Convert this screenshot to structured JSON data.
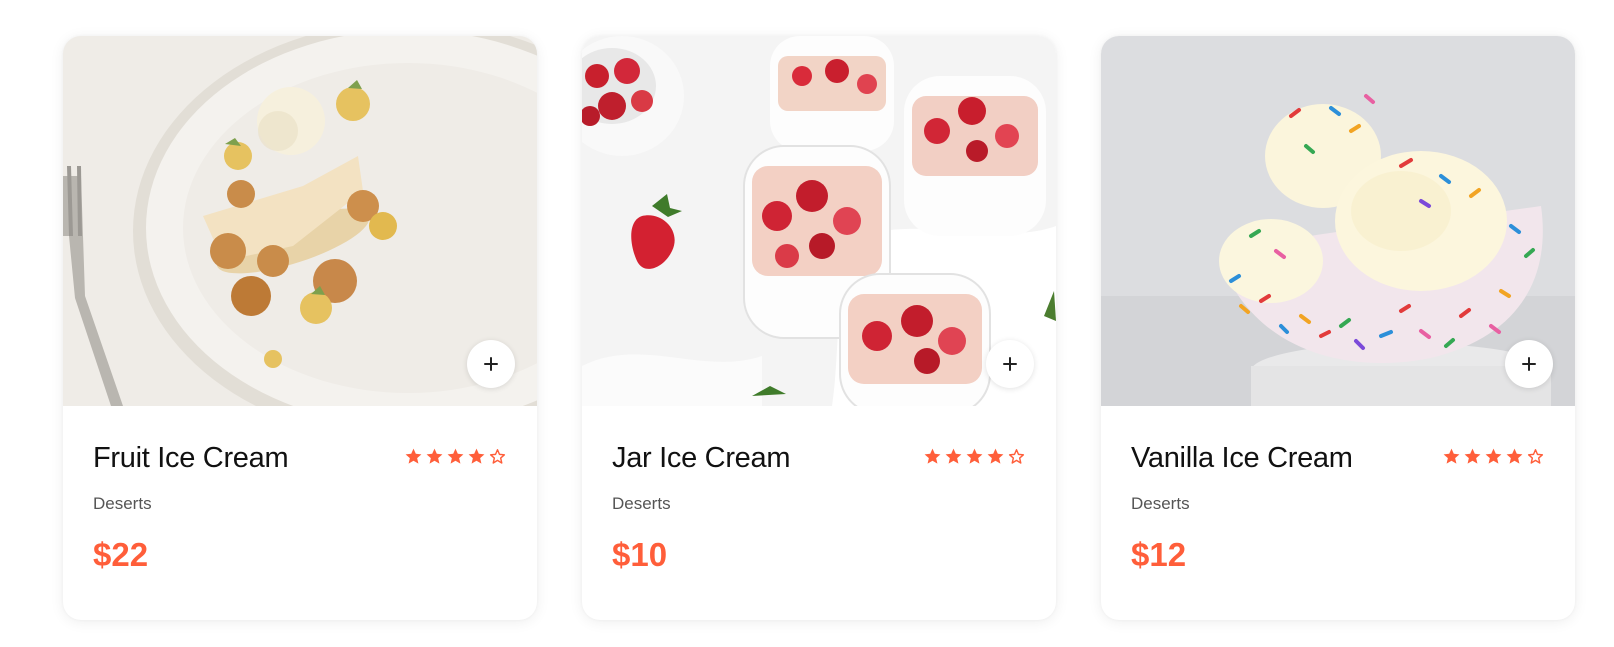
{
  "accent_color": "#ff5e3a",
  "cards": [
    {
      "title": "Fruit Ice Cream",
      "category": "Deserts",
      "price": "$22",
      "rating": 4,
      "rating_max": 5,
      "image_icon": "dessert-plate-photo",
      "add_label": "+"
    },
    {
      "title": "Jar Ice Cream",
      "category": "Deserts",
      "price": "$10",
      "rating": 4,
      "rating_max": 5,
      "image_icon": "strawberry-jars-photo",
      "add_label": "+"
    },
    {
      "title": "Vanilla Ice Cream",
      "category": "Deserts",
      "price": "$12",
      "rating": 4,
      "rating_max": 5,
      "image_icon": "sprinkle-bowl-photo",
      "add_label": "+"
    }
  ]
}
